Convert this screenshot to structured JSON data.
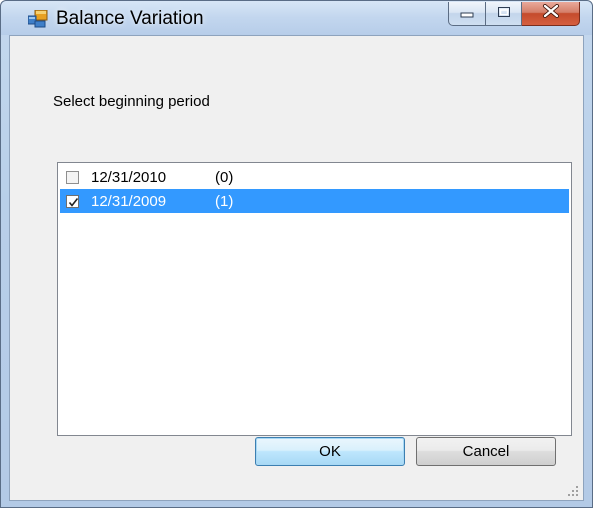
{
  "window": {
    "title": "Balance Variation",
    "icons": {
      "app": "app-window-icon",
      "minimize": "minimize-icon",
      "maximize": "maximize-icon",
      "close": "close-icon"
    }
  },
  "form": {
    "label": "Select beginning period",
    "items": [
      {
        "date": "12/31/2010",
        "count": "(0)",
        "checked": false,
        "selected": false
      },
      {
        "date": "12/31/2009",
        "count": "(1)",
        "checked": true,
        "selected": true
      }
    ]
  },
  "buttons": {
    "ok": "OK",
    "cancel": "Cancel"
  },
  "colors": {
    "selection": "#3399ff",
    "close_button": "#c44b2c",
    "client_bg": "#f0f0f0"
  }
}
